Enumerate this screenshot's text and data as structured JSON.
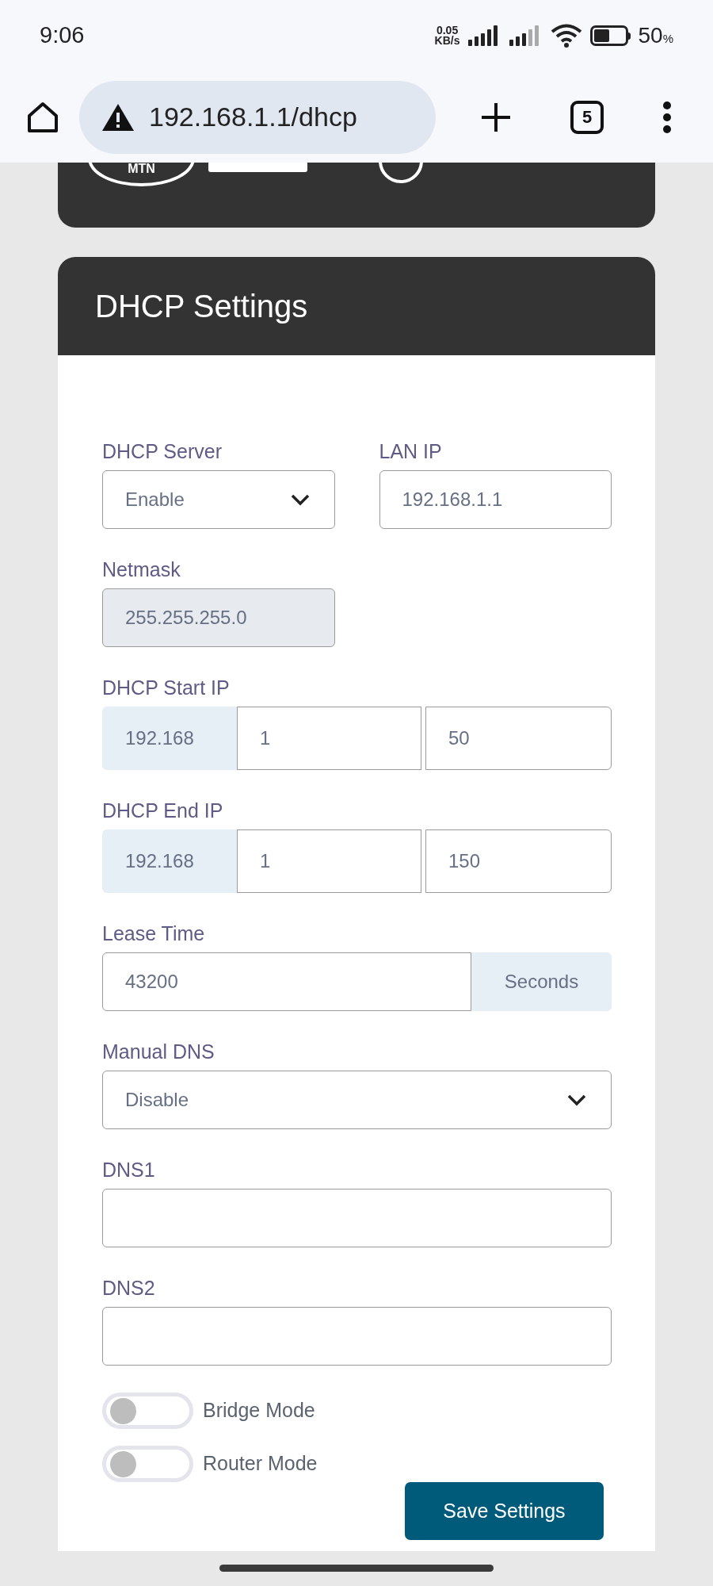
{
  "status_bar": {
    "time": "9:06",
    "net_speed": "0.05",
    "net_unit": "KB/s",
    "battery_text": "50",
    "battery_unit": "%"
  },
  "browser": {
    "url": "192.168.1.1/dhcp",
    "tab_count": "5"
  },
  "header_card": {
    "logo_text": "MTN"
  },
  "dhcp_card": {
    "title": "DHCP Settings",
    "rows": [
      [
        {
          "kind": "select",
          "label": "DHCP Server",
          "value": "Enable"
        },
        {
          "kind": "input",
          "label": "LAN IP",
          "value": "192.168.1.1"
        }
      ],
      [
        {
          "kind": "readonly",
          "label": "Netmask",
          "value": "255.255.255.0"
        }
      ],
      [
        {
          "kind": "ip_group",
          "label": "DHCP Start IP",
          "prefix": "192.168",
          "values": [
            "1",
            "50"
          ]
        }
      ],
      [
        {
          "kind": "ip_group",
          "label": "DHCP End IP",
          "prefix": "192.168",
          "values": [
            "1",
            "150"
          ]
        }
      ],
      [
        {
          "kind": "addon_input",
          "label": "Lease Time",
          "value": "43200",
          "addon": "Seconds"
        }
      ],
      [
        {
          "kind": "select",
          "label": "Manual DNS",
          "value": "Disable"
        }
      ],
      [
        {
          "kind": "input",
          "label": "DNS1"
        }
      ],
      [
        {
          "kind": "input",
          "label": "DNS2"
        }
      ]
    ],
    "toggles": [
      {
        "label": "Bridge Mode",
        "on": false
      },
      {
        "label": "Router Mode",
        "on": false
      }
    ],
    "button": "Save Settings"
  }
}
